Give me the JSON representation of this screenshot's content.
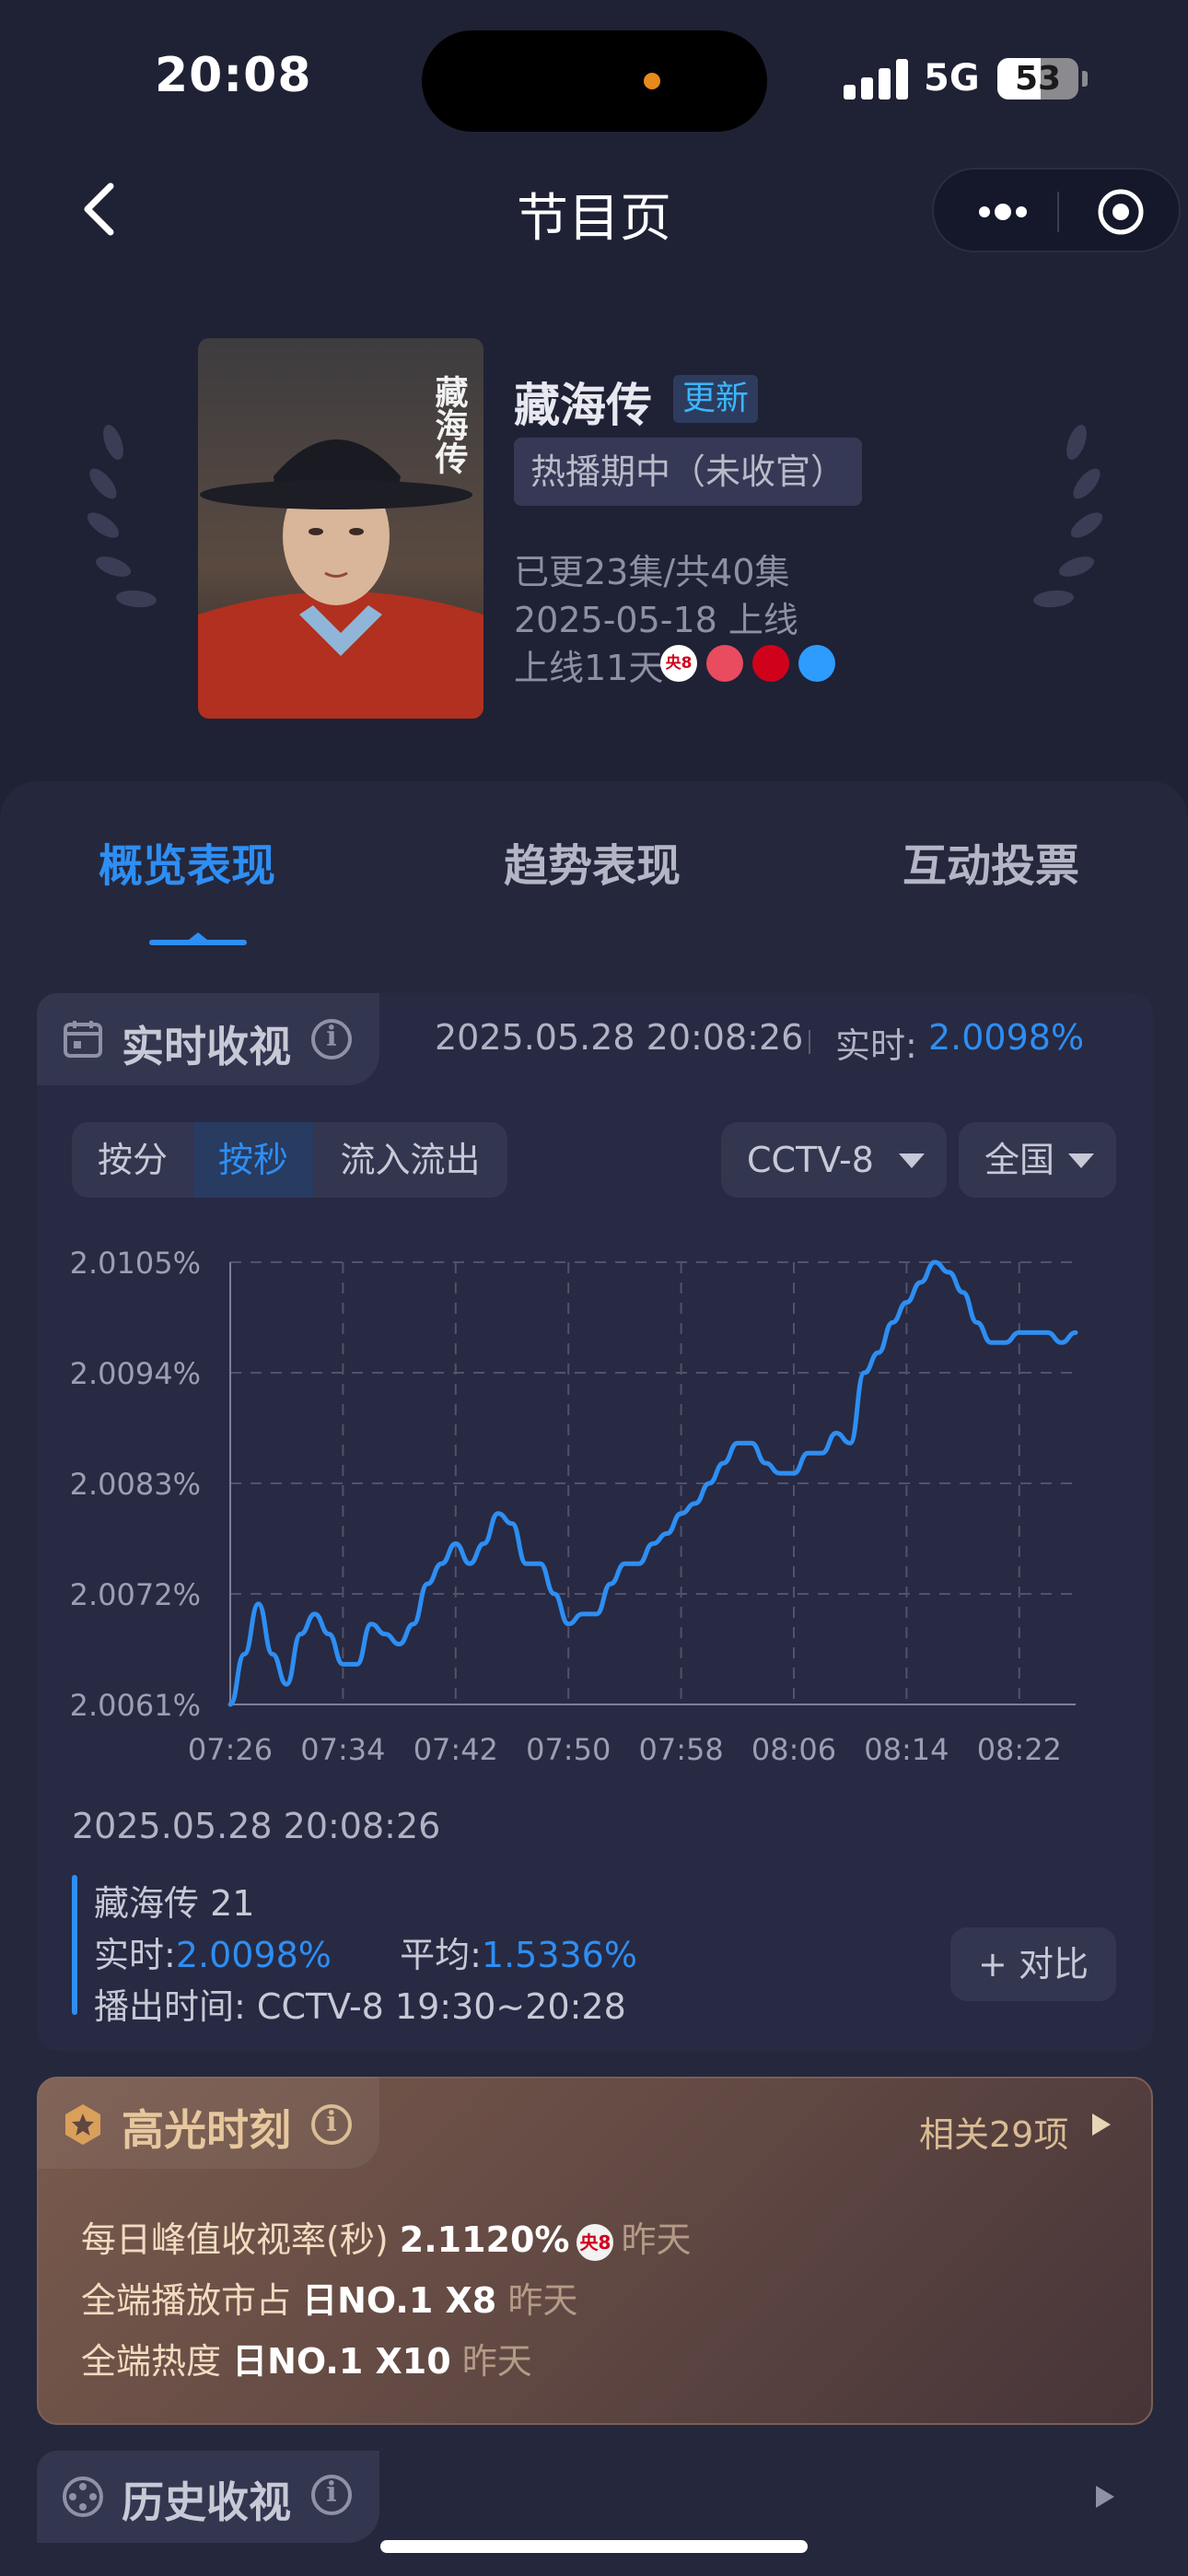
{
  "status_bar": {
    "time": "20:08",
    "network": "5G",
    "battery": "53",
    "battery_level": 0.53
  },
  "nav": {
    "title": "节目页"
  },
  "show": {
    "title": "藏海传",
    "badge": "更新",
    "status": "热播期中（未收官）",
    "episodes": "已更23集/共40集",
    "release": "2025-05-18 上线",
    "days_online": "上线11天",
    "poster_text": "藏海传",
    "platform_icons": [
      {
        "name": "cctv8-icon",
        "label": "央8",
        "color": "#ffffff"
      },
      {
        "name": "youku-icon",
        "label": "",
        "color": "#e94b5f"
      },
      {
        "name": "tencent-video-icon",
        "label": "",
        "color": "#d0021b"
      },
      {
        "name": "tencent-play-icon",
        "label": "",
        "color": "#2e9bff"
      }
    ]
  },
  "tabs": [
    {
      "label": "概览表现",
      "active": true
    },
    {
      "label": "趋势表现",
      "active": false
    },
    {
      "label": "互动投票",
      "active": false
    }
  ],
  "realtime": {
    "section_title": "实时收视",
    "timestamp": "2025.05.28 20:08:26",
    "label": "实时:",
    "value": "2.0098%",
    "segments": [
      "按分",
      "按秒",
      "流入流出"
    ],
    "active_segment": 1,
    "channel": "CCTV-8",
    "region": "全国"
  },
  "chart_data": {
    "type": "line",
    "title": "",
    "xlabel": "",
    "ylabel": "",
    "ylim": [
      2.0061,
      2.0105
    ],
    "y_ticks": [
      "2.0105%",
      "2.0094%",
      "2.0083%",
      "2.0072%",
      "2.0061%"
    ],
    "y_tick_values": [
      2.0105,
      2.0094,
      2.0083,
      2.0072,
      2.0061
    ],
    "x_ticks": [
      "07:26",
      "07:34",
      "07:42",
      "07:50",
      "07:58",
      "08:06",
      "08:14",
      "08:22"
    ],
    "x_range_minutes": [
      446,
      506
    ],
    "grid": true,
    "series": [
      {
        "color": "#2e8ef3",
        "x": [
          446,
          447,
          448,
          449,
          450,
          451,
          452,
          453,
          454,
          455,
          456,
          457,
          458,
          459,
          460,
          461,
          462,
          463,
          464,
          465,
          466,
          467,
          468,
          469,
          470,
          471,
          472,
          473,
          474,
          475,
          476,
          477,
          478,
          479,
          480,
          481,
          482,
          483,
          484,
          485,
          486,
          487,
          488,
          489,
          490,
          491,
          492,
          493,
          494,
          495,
          496,
          497,
          498,
          499,
          500,
          501,
          502,
          503,
          504,
          505,
          506
        ],
        "y": [
          2.0061,
          2.0066,
          2.0071,
          2.0066,
          2.0063,
          2.0068,
          2.007,
          2.0068,
          2.0065,
          2.0065,
          2.0069,
          2.0068,
          2.0067,
          2.0069,
          2.0073,
          2.0075,
          2.0077,
          2.0075,
          2.0077,
          2.008,
          2.0079,
          2.0075,
          2.0075,
          2.0072,
          2.0069,
          2.007,
          2.007,
          2.0073,
          2.0075,
          2.0075,
          2.0077,
          2.0078,
          2.008,
          2.0081,
          2.0083,
          2.0085,
          2.0087,
          2.0087,
          2.0085,
          2.0084,
          2.0084,
          2.0086,
          2.0086,
          2.0088,
          2.0087,
          2.0094,
          2.0096,
          2.0099,
          2.0101,
          2.0103,
          2.0105,
          2.0104,
          2.0102,
          2.0099,
          2.0097,
          2.0097,
          2.0098,
          2.0098,
          2.0098,
          2.0097,
          2.0098
        ]
      }
    ]
  },
  "detail": {
    "timestamp": "2025.05.28 20:08:26",
    "episode": "藏海传 21",
    "rt_label": "实时:",
    "rt_value": "2.0098%",
    "avg_label": "平均:",
    "avg_value": "1.5336%",
    "air_label": "播出时间:",
    "air_value": "CCTV-8 19:30~20:28",
    "compare": "+ 对比"
  },
  "highlights": {
    "title": "高光时刻",
    "related": "相关29项",
    "items": [
      {
        "label": "每日峰值收视率(秒)",
        "value": "2.1120%",
        "badge": "央8",
        "when": "昨天"
      },
      {
        "label": "全端播放市占",
        "value": "日NO.1 X8",
        "when": "昨天"
      },
      {
        "label": "全端热度",
        "value": "日NO.1 X10",
        "when": "昨天"
      }
    ]
  },
  "history": {
    "title": "历史收视"
  }
}
